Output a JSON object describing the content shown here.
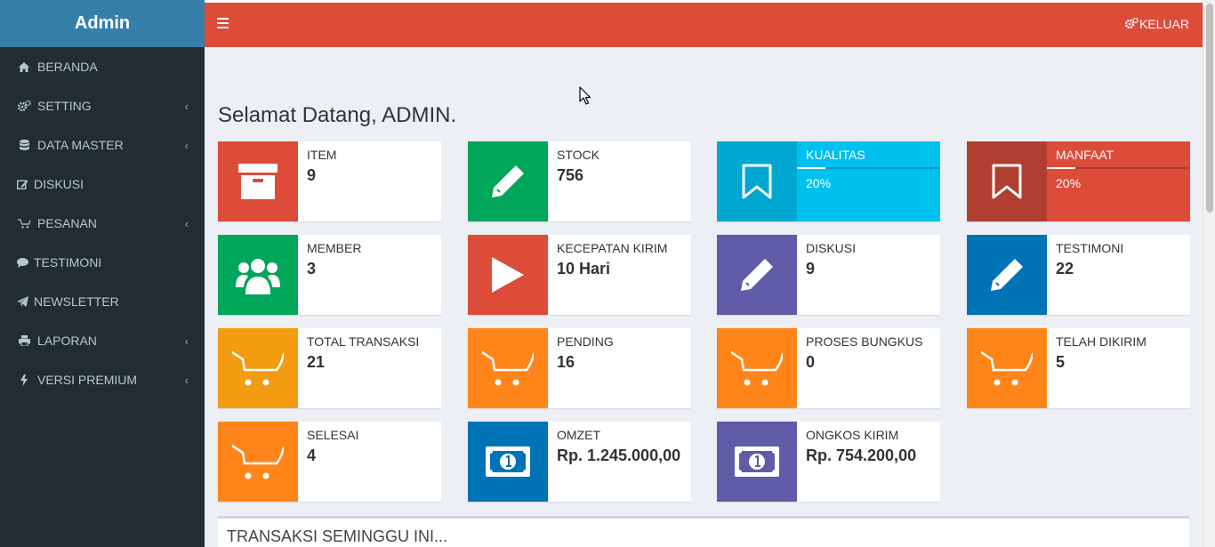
{
  "brand": "Admin",
  "sidebar": {
    "items": [
      {
        "label": "BERANDA",
        "icon": "home-icon",
        "has_chevron": false
      },
      {
        "label": "SETTING",
        "icon": "cogs-icon",
        "has_chevron": true
      },
      {
        "label": "DATA MASTER",
        "icon": "database-icon",
        "has_chevron": true
      },
      {
        "label": "DISKUSI",
        "icon": "edit-icon",
        "has_chevron": false
      },
      {
        "label": "PESANAN",
        "icon": "cart-icon",
        "has_chevron": true
      },
      {
        "label": "TESTIMONI",
        "icon": "comment-icon",
        "has_chevron": false
      },
      {
        "label": "NEWSLETTER",
        "icon": "paper-plane-icon",
        "has_chevron": false
      },
      {
        "label": "LAPORAN",
        "icon": "print-icon",
        "has_chevron": true
      },
      {
        "label": "VERSI PREMIUM",
        "icon": "bolt-icon",
        "has_chevron": true
      }
    ]
  },
  "topbar": {
    "logout_label": "KELUAR",
    "color": "#dd4b39"
  },
  "page": {
    "title": "Selamat Datang, ADMIN."
  },
  "stats": [
    {
      "label": "ITEM",
      "value": "9",
      "icon": "archive-icon",
      "color": "#dd4b39"
    },
    {
      "label": "STOCK",
      "value": "756",
      "icon": "pencil-icon",
      "color": "#00a65a"
    },
    {
      "label": "KUALITAS",
      "percent": "20%",
      "progress": 0.2,
      "icon": "bookmark-icon",
      "color": "#00c0ef",
      "icon_color": "#00a7d0"
    },
    {
      "label": "MANFAAT",
      "percent": "20%",
      "progress": 0.2,
      "icon": "bookmark-icon",
      "color": "#dd4b39",
      "icon_color": "#b13f31"
    },
    {
      "label": "MEMBER",
      "value": "3",
      "icon": "users-icon",
      "color": "#00a65a"
    },
    {
      "label": "KECEPATAN KIRIM",
      "value": "10 Hari",
      "icon": "play-icon",
      "color": "#dd4b39"
    },
    {
      "label": "DISKUSI",
      "value": "9",
      "icon": "pencil-icon",
      "color": "#605ca8"
    },
    {
      "label": "TESTIMONI",
      "value": "22",
      "icon": "pencil-icon",
      "color": "#0073b7"
    },
    {
      "label": "TOTAL TRANSAKSI",
      "value": "21",
      "icon": "cart-icon",
      "color": "#f39c12"
    },
    {
      "label": "PENDING",
      "value": "16",
      "icon": "cart-icon",
      "color": "#ff851b"
    },
    {
      "label": "PROSES BUNGKUS",
      "value": "0",
      "icon": "cart-icon",
      "color": "#ff851b"
    },
    {
      "label": "TELAH DIKIRIM",
      "value": "5",
      "icon": "cart-icon",
      "color": "#ff851b"
    },
    {
      "label": "SELESAI",
      "value": "4",
      "icon": "cart-icon",
      "color": "#ff851b"
    },
    {
      "label": "OMZET",
      "value": "Rp. 1.245.000,00",
      "icon": "money-icon",
      "color": "#0073b7"
    },
    {
      "label": "ONGKOS KIRIM",
      "value": "Rp. 754.200,00",
      "icon": "money-icon",
      "color": "#605ca8"
    }
  ],
  "panel": {
    "title": "TRANSAKSI SEMINGGU INI..."
  }
}
